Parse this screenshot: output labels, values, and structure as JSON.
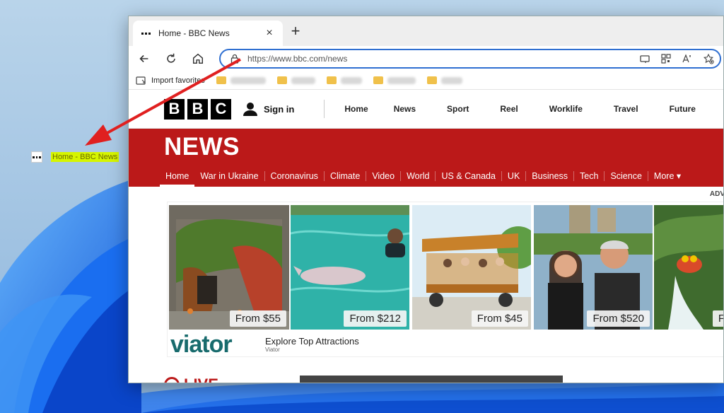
{
  "desktop": {
    "shortcut_label": "Home - BBC News"
  },
  "browser": {
    "tab": {
      "title": "Home - BBC News",
      "close": "×"
    },
    "new_tab": "+",
    "address": {
      "url": "https://www.bbc.com/news"
    },
    "favorites": {
      "import_label": "Import favorites"
    }
  },
  "bbc": {
    "logo": [
      "B",
      "B",
      "C"
    ],
    "sign_in": "Sign in",
    "top_nav": [
      "Home",
      "News",
      "Sport",
      "Reel",
      "Worklife",
      "Travel",
      "Future"
    ],
    "news_title": "NEWS",
    "news_nav": [
      "Home",
      "War in Ukraine",
      "Coronavirus",
      "Climate",
      "Video",
      "World",
      "US & Canada",
      "UK",
      "Business",
      "Tech",
      "Science",
      "More ▾"
    ],
    "adv_label": "ADV",
    "ads": {
      "prices": [
        "From $55",
        "From $212",
        "From $45",
        "From $520",
        "F"
      ],
      "brand": "viator",
      "tagline": "Explore Top Attractions",
      "sub": "Viator"
    },
    "live": {
      "label": "LIVE"
    }
  },
  "colors": {
    "bbc_red": "#bb1919",
    "address_focus": "#2f6fd1",
    "viator_teal": "#186b6d",
    "shortcut_highlight": "#d6f500",
    "arrow": "#e02020"
  }
}
